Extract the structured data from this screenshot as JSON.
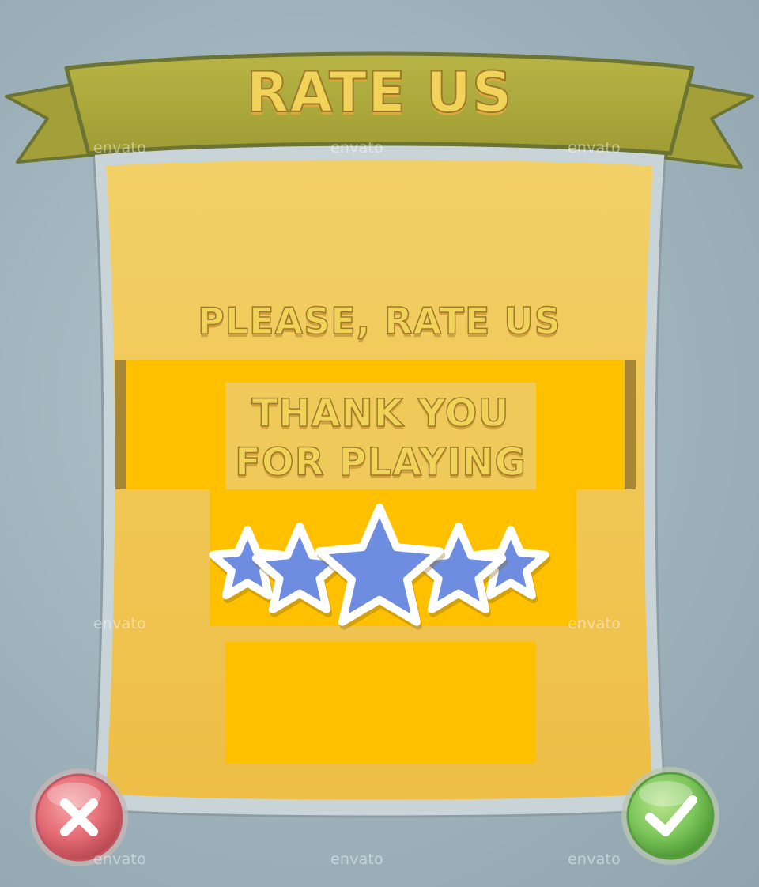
{
  "dialog": {
    "title": "RATE US",
    "subtitle": "PLEASE, RATE US",
    "thank_you_line1": "THANK YOU",
    "thank_you_line2": "FOR PLAYING"
  },
  "rating": {
    "stars_filled": 5,
    "stars_total": 5
  },
  "buttons": {
    "close_icon": "close-x-icon",
    "confirm_icon": "checkmark-icon"
  },
  "watermark": "envato",
  "colors": {
    "ribbon": "#a9a83c",
    "panel": "#efc95a",
    "panel_bright": "#ffc000",
    "star_fill": "#6f8de0",
    "close_button": "#e46c75",
    "confirm_button": "#7dc65b"
  }
}
